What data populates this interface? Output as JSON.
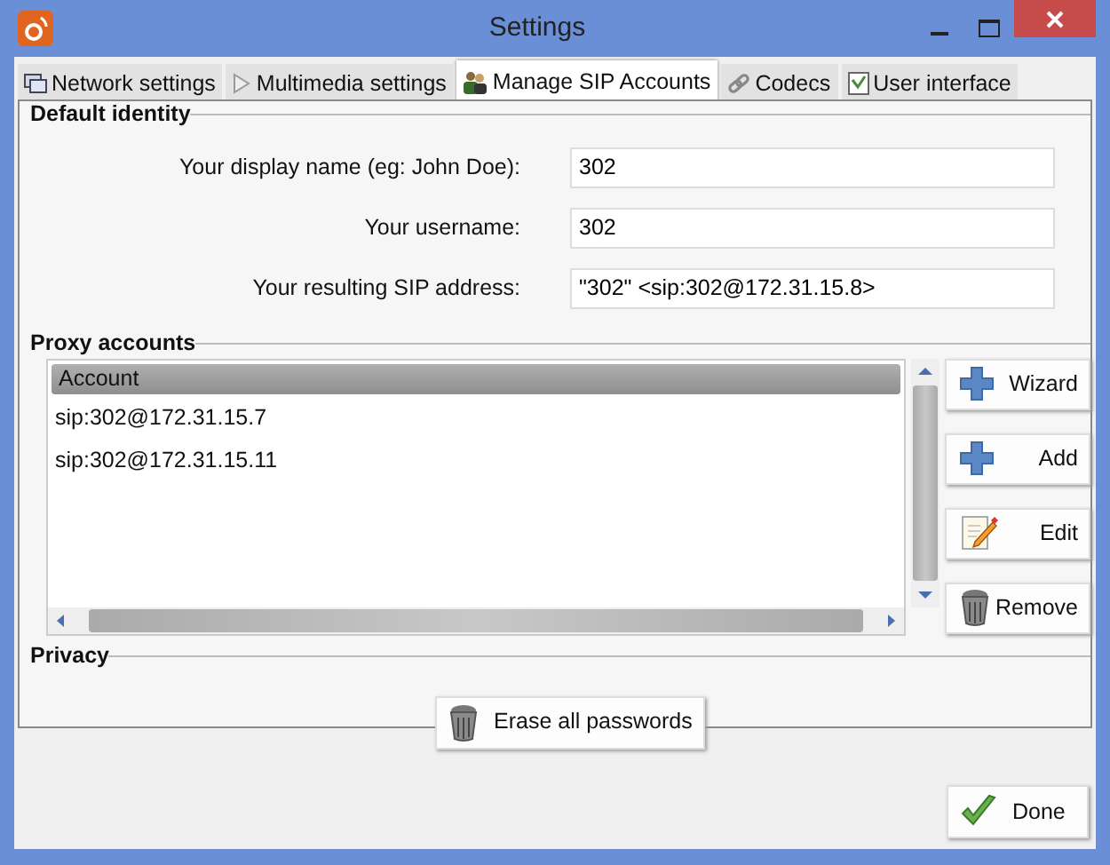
{
  "window": {
    "title": "Settings"
  },
  "tabs": [
    {
      "label": "Network settings",
      "selected": false
    },
    {
      "label": "Multimedia settings",
      "selected": false
    },
    {
      "label": "Manage SIP Accounts",
      "selected": true
    },
    {
      "label": "Codecs",
      "selected": false
    },
    {
      "label": "User interface",
      "selected": false
    }
  ],
  "default_identity": {
    "title": "Default identity",
    "fields": [
      {
        "label": "Your display name (eg: John Doe):",
        "value": "302"
      },
      {
        "label": "Your username:",
        "value": "302"
      },
      {
        "label": "Your resulting SIP address:",
        "value": "\"302\" <sip:302@172.31.15.8>"
      }
    ]
  },
  "proxy_accounts": {
    "title": "Proxy accounts",
    "columns": [
      "Account"
    ],
    "rows": [
      "sip:302@172.31.15.7",
      "sip:302@172.31.15.11"
    ],
    "buttons": [
      "Wizard",
      "Add",
      "Edit",
      "Remove"
    ]
  },
  "privacy": {
    "title": "Privacy",
    "button": "Erase all passwords"
  },
  "footer": {
    "button": "Done"
  }
}
